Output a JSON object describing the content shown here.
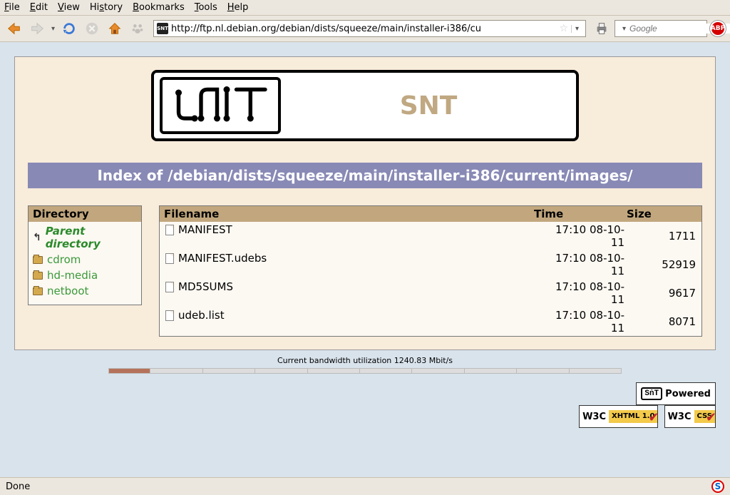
{
  "menu": [
    "File",
    "Edit",
    "View",
    "History",
    "Bookmarks",
    "Tools",
    "Help"
  ],
  "toolbar": {
    "url": "http://ftp.nl.debian.org/debian/dists/squeeze/main/installer-i386/cu",
    "search_placeholder": "Google"
  },
  "page": {
    "header_title": "SNT",
    "index_title": "Index of /debian/dists/squeeze/main/installer-i386/current/images/",
    "dir_header": "Directory",
    "file_headers": {
      "name": "Filename",
      "time": "Time",
      "size": "Size"
    },
    "dirs": [
      {
        "label": "Parent directory",
        "parent": true
      },
      {
        "label": "cdrom"
      },
      {
        "label": "hd-media"
      },
      {
        "label": "netboot"
      }
    ],
    "files": [
      {
        "name": "MANIFEST",
        "time": "17:10 08-10-11",
        "size": "1711"
      },
      {
        "name": "MANIFEST.udebs",
        "time": "17:10 08-10-11",
        "size": "52919"
      },
      {
        "name": "MD5SUMS",
        "time": "17:10 08-10-11",
        "size": "9617"
      },
      {
        "name": "udeb.list",
        "time": "17:10 08-10-11",
        "size": "8071"
      }
    ],
    "bandwidth": "Current bandwidth utilization 1240.83 Mbit/s",
    "badges": {
      "powered": "Powered",
      "xhtml": "XHTML\n1.0",
      "css": "CSS"
    }
  },
  "status": {
    "text": "Done"
  }
}
